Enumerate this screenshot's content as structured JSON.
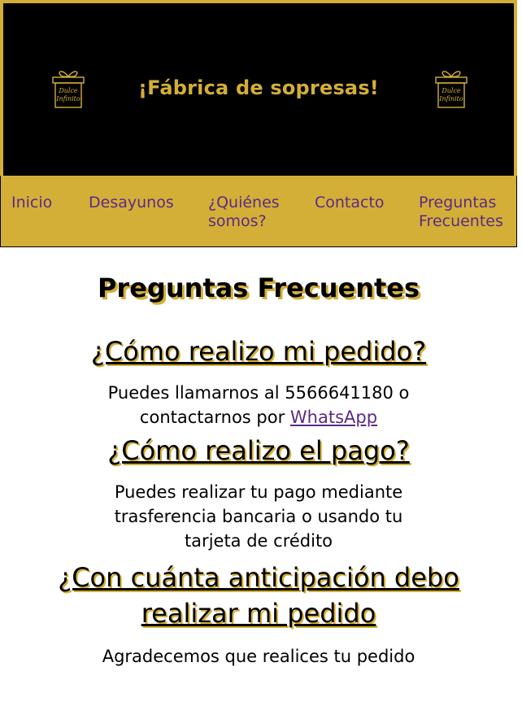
{
  "header": {
    "title": "¡Fábrica de sopresas!",
    "logo_text_line1": "Dulce",
    "logo_text_line2": "Infinito",
    "logo_icon": "gift-box-icon",
    "colors": {
      "background": "#000000",
      "accent": "#d4af37"
    }
  },
  "nav": {
    "items": [
      {
        "label": "Inicio"
      },
      {
        "label": "Desayunos"
      },
      {
        "label": "¿Quiénes somos?"
      },
      {
        "label": "Contacto"
      },
      {
        "label": "Preguntas Frecuentes"
      }
    ],
    "colors": {
      "background": "#d4af37",
      "link": "#5b2a86"
    }
  },
  "main": {
    "title": "Preguntas Frecuentes",
    "faqs": [
      {
        "question": "¿Cómo realizo mi pedido?",
        "answer_prefix": "Puedes llamarnos al 5566641180 o contactarnos por",
        "answer_link": "WhatsApp"
      },
      {
        "question": "¿Cómo realizo el pago?",
        "answer": "Puedes realizar tu pago mediante trasferencia bancaria o usando tu tarjeta de crédito"
      },
      {
        "question": "¿Con cuánta anticipación debo realizar mi pedido",
        "answer": "Agradecemos que realices tu pedido"
      }
    ]
  }
}
